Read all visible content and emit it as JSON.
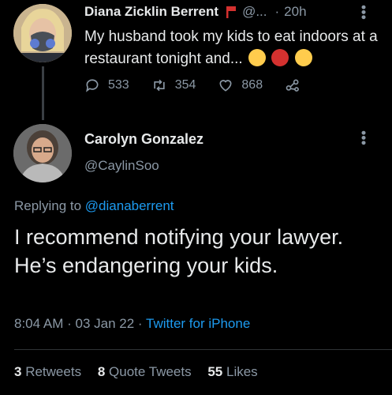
{
  "colors": {
    "background": "#000000",
    "text": "#e7e9ea",
    "muted": "#8b98a5",
    "link": "#1d9bf0"
  },
  "parent_tweet": {
    "author_name": "Diana Zicklin Berrent",
    "handle_truncated": "@...",
    "time": "20h",
    "text": "My husband took my kids to eat indoors at a restaurant tonight and...",
    "emojis": [
      "exploding-head-emoji",
      "cursing-face-emoji",
      "exploding-head-emoji"
    ],
    "replies": "533",
    "retweets": "354",
    "likes": "868"
  },
  "reply_tweet": {
    "author_name": "Carolyn Gonzalez",
    "handle": "@CaylinSoo",
    "replying_prefix": "Replying to",
    "replying_to": "@dianaberrent",
    "text": "I recommend notifying your lawyer.  He’s endangering your kids.",
    "time": "8:04 AM",
    "date": "03 Jan 22",
    "source": "Twitter for iPhone",
    "retweet_count": "3",
    "retweet_label": "Retweets",
    "quote_count": "8",
    "quote_label": "Quote Tweets",
    "like_count": "55",
    "like_label": "Likes"
  }
}
